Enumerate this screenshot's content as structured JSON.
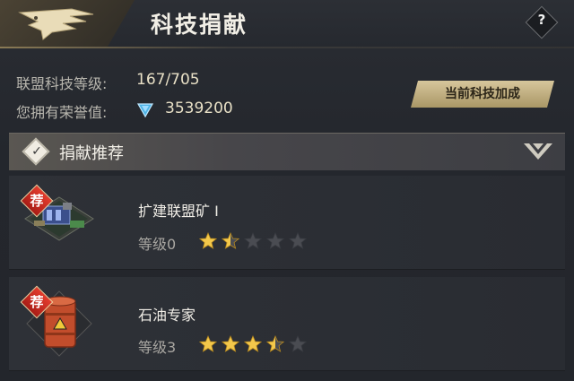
{
  "header": {
    "title": "科技捐献",
    "help_label": "?"
  },
  "info": {
    "tech_level_label": "联盟科技等级:",
    "tech_level_value": "167/705",
    "honor_label": "您拥有荣誉值:",
    "honor_value": "3539200",
    "boost_button": "当前科技加成"
  },
  "section": {
    "title": "捐献推荐"
  },
  "items": [
    {
      "badge": "荐",
      "name": "扩建联盟矿 I",
      "level": "等级0",
      "stars": 1.5
    },
    {
      "badge": "荐",
      "name": "石油专家",
      "level": "等级3",
      "stars": 3.5
    }
  ],
  "colors": {
    "accent_gold": "#d7c69c",
    "star_filled": "#f3c84b",
    "star_empty": "#4a4c52",
    "badge_red": "#d32f22"
  }
}
